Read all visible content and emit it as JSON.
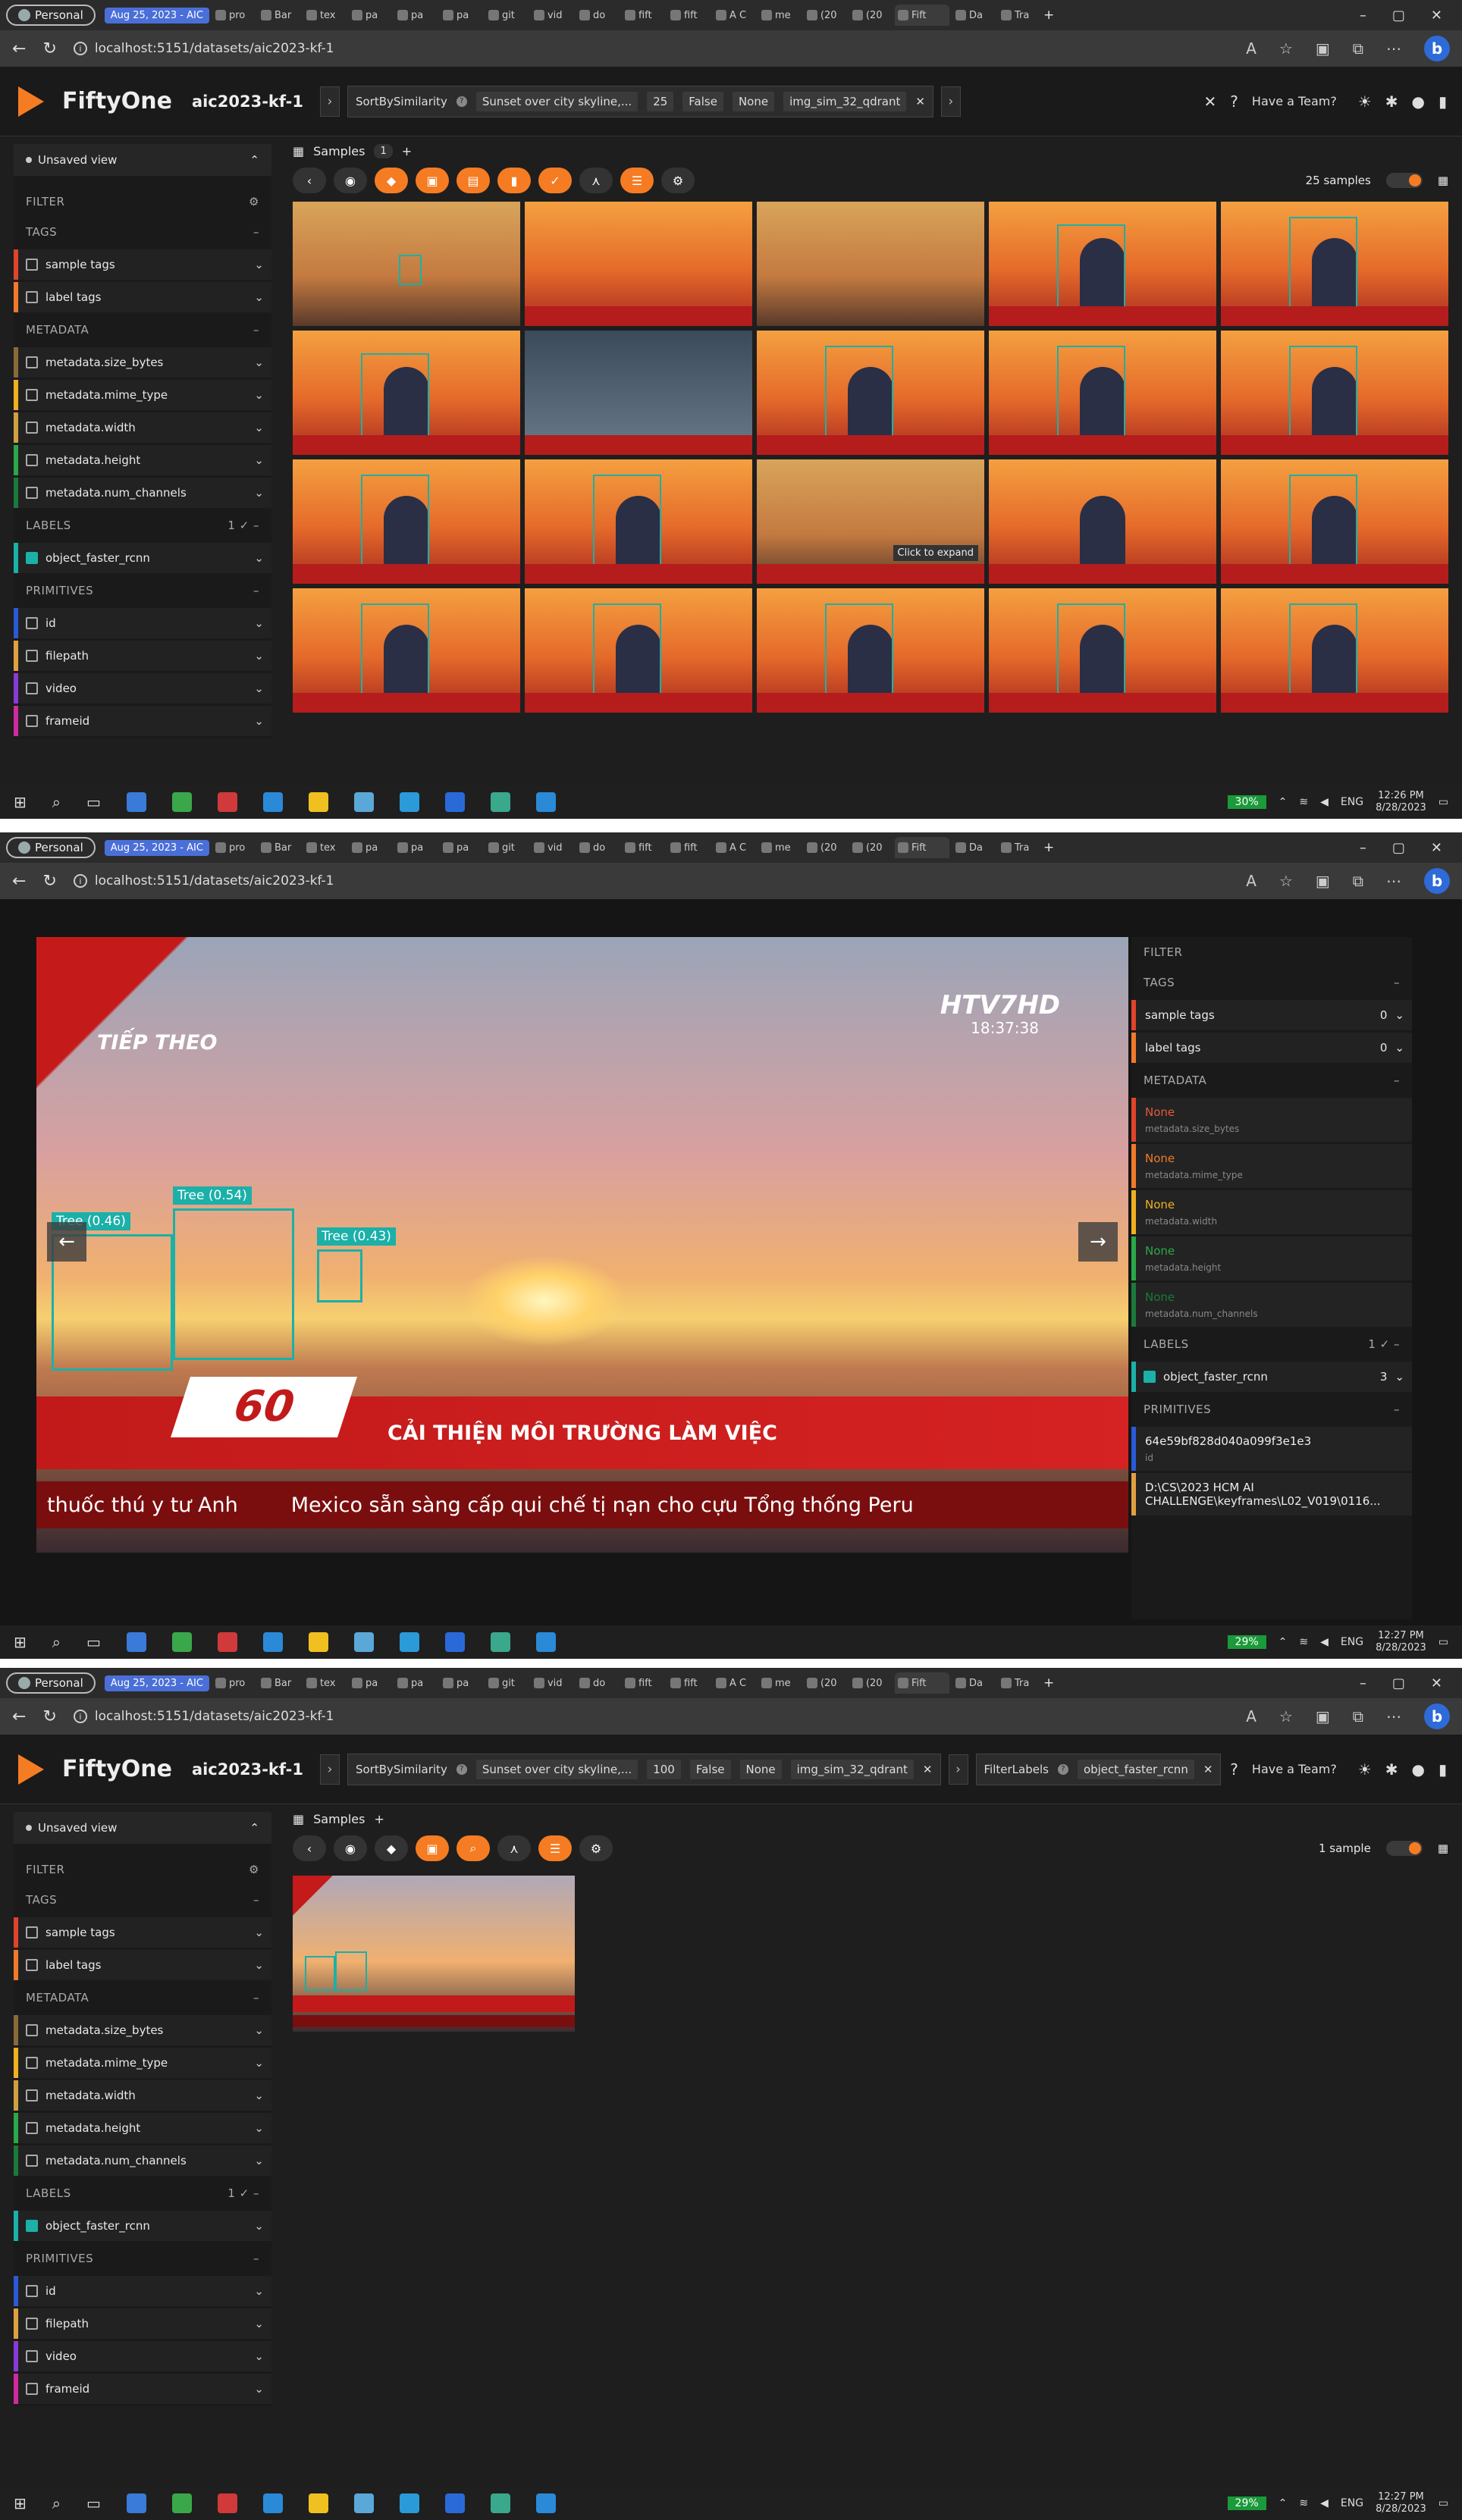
{
  "browser": {
    "profile": "Personal",
    "group": "Aug 25, 2023 - AIC",
    "tabs": [
      "pro",
      "Bar",
      "tex",
      "pa",
      "pa",
      "pa",
      "git",
      "vid",
      "do",
      "fift",
      "fift",
      "A C",
      "me",
      "(20",
      "(20",
      "Fift",
      "Da",
      "Tra"
    ],
    "url": "localhost:5151/datasets/aic2023-kf-1"
  },
  "app": {
    "brand": "FiftyOne",
    "dataset": "aic2023-kf-1",
    "have_team": "Have a Team?",
    "view_label": "Unsaved view",
    "filter_label": "FILTER"
  },
  "shot1": {
    "stage": {
      "name": "SortBySimilarity",
      "query": "Sunset over city skyline,...",
      "k": "25",
      "reverse": "False",
      "dist": "None",
      "brain": "img_sim_32_qdrant"
    },
    "samples_tab": "Samples",
    "samples_badge": "1",
    "count": "25 samples",
    "expand_tip": "Click to expand"
  },
  "shot3": {
    "stage": {
      "name": "SortBySimilarity",
      "query": "Sunset over city skyline,...",
      "k": "100",
      "reverse": "False",
      "dist": "None",
      "brain": "img_sim_32_qdrant"
    },
    "stage2": {
      "name": "FilterLabels",
      "field": "object_faster_rcnn"
    },
    "count": "1 sample"
  },
  "sidebar": {
    "sections": {
      "tags": "TAGS",
      "metadata": "METADATA",
      "labels": "LABELS",
      "primitives": "PRIMITIVES"
    },
    "labels_badge": "1",
    "tags": [
      "sample tags",
      "label tags"
    ],
    "metadata": [
      "metadata.size_bytes",
      "metadata.mime_type",
      "metadata.width",
      "metadata.height",
      "metadata.num_channels"
    ],
    "labels": [
      "object_faster_rcnn"
    ],
    "primitives": [
      "id",
      "filepath",
      "video",
      "frameid"
    ],
    "colors": [
      "#e0442a",
      "#f07a2a",
      "#8a6a3a",
      "#f0b020",
      "#2aa84a",
      "#d0a040",
      "#1bb0a8",
      "#2a5ad8",
      "#e0a040",
      "#8a3ad8",
      "#d02aa0"
    ]
  },
  "modal": {
    "overlay_top_left": "TIẾP THEO",
    "channel": "HTV7HD",
    "time": "18:37:38",
    "labels": [
      "Tree (0.46)",
      "Tree (0.54)",
      "Tree (0.43)"
    ],
    "logo": "60",
    "headline": "CẢI THIỆN MÔI TRƯỜNG LÀM VIỆC",
    "ticker_left": "thuốc thú y tư Anh",
    "ticker_right": "Mexico sẵn sàng cấp qui chế tị nạn cho cựu Tổng thống Peru",
    "side": {
      "tag_values": [
        "0",
        "0"
      ],
      "meta_values": [
        "None",
        "None",
        "None",
        "None",
        "None"
      ],
      "label_count": "3",
      "id_value": "64e59bf828d040a099f3e1e3",
      "id_key": "id",
      "filepath_value": "D:\\CS\\2023 HCM AI CHALLENGE\\keyframes\\L02_V019\\0116..."
    }
  },
  "taskbar": {
    "battery1": "30%",
    "battery2": "29%",
    "lang": "ENG",
    "time1": "12:26 PM",
    "time2": "12:27 PM",
    "time3": "12:27 PM",
    "date": "8/28/2023"
  }
}
